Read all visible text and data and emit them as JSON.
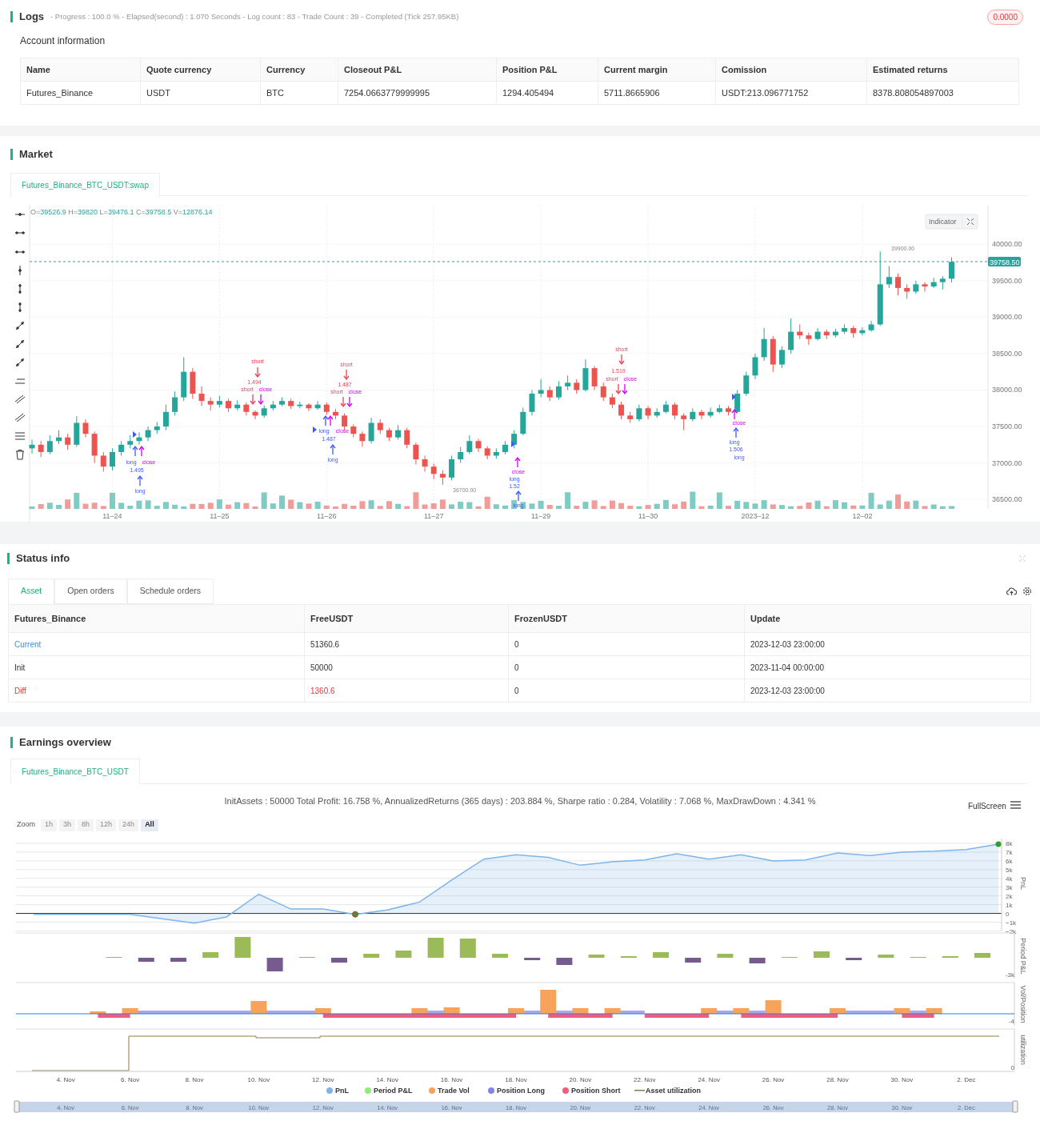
{
  "logs": {
    "title": "Logs",
    "summary": "- Progress : 100.0 % - Elapsed(second) : 1.070  Seconds - Log count : 83 - Trade Count : 39 - Completed (Tick 257.95KB)",
    "badge": "0.0000"
  },
  "account": {
    "title": "Account information",
    "columns": [
      "Name",
      "Quote currency",
      "Currency",
      "Closeout P&L",
      "Position P&L",
      "Current margin",
      "Comission",
      "Estimated returns"
    ],
    "rows": [
      [
        "Futures_Binance",
        "USDT",
        "BTC",
        "7254.0663779999995",
        "1294.405494",
        "5711.8665906",
        "USDT:213.096771752",
        "8378.808054897003"
      ]
    ]
  },
  "market": {
    "title": "Market",
    "tabs": [
      {
        "label": "Futures_Binance_BTC_USDT:swap",
        "selected": true
      }
    ],
    "ohlc": [
      {
        "key": "O=",
        "value": "39526.9"
      },
      {
        "key": "H=",
        "value": "39820"
      },
      {
        "key": "L=",
        "value": "39476.1"
      },
      {
        "key": "C=",
        "value": "39758.5"
      },
      {
        "key": "V=",
        "value": "12876.14"
      }
    ],
    "indicator_button": "Indicator",
    "last_price": "39758.50",
    "high_label": "39900.00",
    "low_label": "36700.00",
    "chart_data": {
      "type": "candlestick",
      "grid": true,
      "ylim": [
        36370,
        40540
      ],
      "categories": [
        null,
        null,
        null,
        null,
        null,
        null,
        null,
        null,
        null,
        "11–24",
        null,
        null,
        null,
        null,
        null,
        null,
        null,
        null,
        null,
        null,
        null,
        "11–25",
        null,
        null,
        null,
        null,
        null,
        null,
        null,
        null,
        null,
        null,
        null,
        "11–26",
        null,
        null,
        null,
        null,
        null,
        null,
        null,
        null,
        null,
        null,
        null,
        "11–27",
        null,
        null,
        null,
        null,
        null,
        null,
        null,
        null,
        null,
        null,
        null,
        "11–29",
        null,
        null,
        null,
        null,
        null,
        null,
        null,
        null,
        null,
        null,
        null,
        "11–30",
        null,
        null,
        null,
        null,
        null,
        null,
        null,
        null,
        null,
        null,
        null,
        "2023–12",
        null,
        null,
        null,
        null,
        null,
        null,
        null,
        null,
        null,
        null,
        null,
        "12–02",
        null,
        null,
        null,
        null,
        null,
        null,
        null,
        null,
        null,
        null
      ],
      "ohlc": [
        [
          37200,
          37320,
          37130,
          37250
        ],
        [
          37250,
          37300,
          37080,
          37150
        ],
        [
          37150,
          37380,
          37120,
          37300
        ],
        [
          37300,
          37450,
          37260,
          37350
        ],
        [
          37350,
          37400,
          37180,
          37250
        ],
        [
          37250,
          37640,
          37220,
          37550
        ],
        [
          37550,
          37600,
          37350,
          37400
        ],
        [
          37400,
          37430,
          37000,
          37100
        ],
        [
          37100,
          37150,
          36880,
          36950
        ],
        [
          36950,
          37200,
          36900,
          37150
        ],
        [
          37150,
          37300,
          37100,
          37250
        ],
        [
          37250,
          37380,
          37200,
          37300
        ],
        [
          37300,
          37420,
          37250,
          37350
        ],
        [
          37350,
          37500,
          37300,
          37450
        ],
        [
          37450,
          37560,
          37400,
          37500
        ],
        [
          37500,
          37800,
          37450,
          37700
        ],
        [
          37700,
          37980,
          37650,
          37900
        ],
        [
          37900,
          38450,
          37850,
          38250
        ],
        [
          38250,
          38300,
          37880,
          37950
        ],
        [
          37950,
          38050,
          37780,
          37850
        ],
        [
          37850,
          37900,
          37720,
          37800
        ],
        [
          37800,
          37920,
          37760,
          37850
        ],
        [
          37850,
          37880,
          37700,
          37750
        ],
        [
          37750,
          37860,
          37720,
          37800
        ],
        [
          37800,
          37830,
          37650,
          37700
        ],
        [
          37700,
          37720,
          37600,
          37650
        ],
        [
          37650,
          37790,
          37620,
          37750
        ],
        [
          37750,
          37850,
          37720,
          37800
        ],
        [
          37800,
          37900,
          37780,
          37850
        ],
        [
          37850,
          37880,
          37740,
          37780
        ],
        [
          37780,
          37840,
          37750,
          37800
        ],
        [
          37800,
          37820,
          37710,
          37750
        ],
        [
          37750,
          37850,
          37730,
          37800
        ],
        [
          37800,
          37830,
          37660,
          37700
        ],
        [
          37700,
          37740,
          37600,
          37650
        ],
        [
          37650,
          37680,
          37450,
          37500
        ],
        [
          37500,
          37530,
          37350,
          37400
        ],
        [
          37400,
          37430,
          37220,
          37300
        ],
        [
          37300,
          37620,
          37270,
          37550
        ],
        [
          37550,
          37600,
          37400,
          37450
        ],
        [
          37450,
          37480,
          37300,
          37350
        ],
        [
          37350,
          37520,
          37320,
          37450
        ],
        [
          37450,
          37480,
          37200,
          37250
        ],
        [
          37250,
          37280,
          36980,
          37050
        ],
        [
          37050,
          37100,
          36880,
          36950
        ],
        [
          36950,
          36990,
          36780,
          36850
        ],
        [
          36850,
          36900,
          36700,
          36800
        ],
        [
          36800,
          37100,
          36760,
          37050
        ],
        [
          37050,
          37220,
          37000,
          37150
        ],
        [
          37150,
          37380,
          37120,
          37300
        ],
        [
          37300,
          37330,
          37150,
          37200
        ],
        [
          37200,
          37230,
          37050,
          37100
        ],
        [
          37100,
          37200,
          37060,
          37150
        ],
        [
          37150,
          37300,
          37120,
          37250
        ],
        [
          37250,
          37450,
          37200,
          37400
        ],
        [
          37400,
          37760,
          37380,
          37700
        ],
        [
          37700,
          38000,
          37650,
          37950
        ],
        [
          37950,
          38150,
          37900,
          38000
        ],
        [
          38000,
          38050,
          37850,
          37900
        ],
        [
          37900,
          38120,
          37870,
          38050
        ],
        [
          38050,
          38200,
          38000,
          38100
        ],
        [
          38100,
          38150,
          37950,
          38000
        ],
        [
          38000,
          38420,
          37980,
          38300
        ],
        [
          38300,
          38330,
          38000,
          38050
        ],
        [
          38050,
          38100,
          37850,
          37900
        ],
        [
          37900,
          37950,
          37750,
          37800
        ],
        [
          37800,
          37840,
          37600,
          37650
        ],
        [
          37650,
          37700,
          37550,
          37600
        ],
        [
          37600,
          37800,
          37570,
          37750
        ],
        [
          37750,
          37780,
          37600,
          37650
        ],
        [
          37650,
          37750,
          37620,
          37700
        ],
        [
          37700,
          37850,
          37680,
          37800
        ],
        [
          37800,
          37830,
          37600,
          37650
        ],
        [
          37650,
          37680,
          37450,
          37600
        ],
        [
          37600,
          37750,
          37570,
          37700
        ],
        [
          37700,
          37730,
          37600,
          37650
        ],
        [
          37650,
          37760,
          37620,
          37700
        ],
        [
          37700,
          37800,
          37680,
          37750
        ],
        [
          37750,
          37780,
          37650,
          37700
        ],
        [
          37700,
          38000,
          37680,
          37950
        ],
        [
          37950,
          38250,
          37920,
          38200
        ],
        [
          38200,
          38500,
          38150,
          38450
        ],
        [
          38450,
          38850,
          38400,
          38700
        ],
        [
          38700,
          38740,
          38250,
          38350
        ],
        [
          38350,
          38600,
          38300,
          38550
        ],
        [
          38550,
          38980,
          38500,
          38800
        ],
        [
          38800,
          38900,
          38700,
          38750
        ],
        [
          38750,
          38790,
          38620,
          38700
        ],
        [
          38700,
          38850,
          38680,
          38800
        ],
        [
          38800,
          38830,
          38700,
          38750
        ],
        [
          38750,
          38840,
          38720,
          38800
        ],
        [
          38800,
          38900,
          38770,
          38850
        ],
        [
          38850,
          38880,
          38720,
          38780
        ],
        [
          38780,
          38860,
          38750,
          38820
        ],
        [
          38820,
          38950,
          38800,
          38900
        ],
        [
          38900,
          39900,
          38880,
          39450
        ],
        [
          39450,
          39700,
          39400,
          39550
        ],
        [
          39550,
          39600,
          39300,
          39400
        ],
        [
          39400,
          39450,
          39250,
          39350
        ],
        [
          39350,
          39500,
          39320,
          39450
        ],
        [
          39450,
          39480,
          39350,
          39420
        ],
        [
          39420,
          39540,
          39400,
          39480
        ],
        [
          39480,
          39560,
          39380,
          39526.9
        ],
        [
          39526.9,
          39820,
          39476.1,
          39758.5
        ]
      ],
      "yticks": [
        {
          "value": 40000,
          "label": "40000.00"
        },
        {
          "value": 39500,
          "label": "39500.00"
        },
        {
          "value": 39000,
          "label": "39000.00"
        },
        {
          "value": 38500,
          "label": "38500.00"
        },
        {
          "value": 38000,
          "label": "38000.00"
        },
        {
          "value": 37500,
          "label": "37500.00"
        },
        {
          "value": 37000,
          "label": "37000.00"
        },
        {
          "value": 36500,
          "label": "36500.00"
        }
      ]
    },
    "markers": [
      {
        "kind": "long",
        "label": "long"
      },
      {
        "kind": "close",
        "label": "close"
      },
      {
        "kind": "long",
        "label": "1.495"
      },
      {
        "kind": "long",
        "label": "long"
      },
      {
        "kind": "short",
        "label": "short"
      },
      {
        "kind": "short",
        "label": "1.494"
      },
      {
        "kind": "short",
        "label": "short"
      },
      {
        "kind": "close",
        "label": "close"
      },
      {
        "kind": "long",
        "label": "long"
      },
      {
        "kind": "close",
        "label": "close"
      },
      {
        "kind": "long",
        "label": "1.487"
      },
      {
        "kind": "long",
        "label": "long"
      },
      {
        "kind": "short",
        "label": "short"
      },
      {
        "kind": "short",
        "label": "1.487"
      },
      {
        "kind": "short",
        "label": "short"
      },
      {
        "kind": "close",
        "label": "close"
      },
      {
        "kind": "close",
        "label": "close"
      },
      {
        "kind": "long",
        "label": "long"
      },
      {
        "kind": "long",
        "label": "1.52"
      },
      {
        "kind": "long",
        "label": "long"
      },
      {
        "kind": "short",
        "label": "short"
      },
      {
        "kind": "short",
        "label": "1.519"
      },
      {
        "kind": "short",
        "label": "short"
      },
      {
        "kind": "close",
        "label": "close"
      },
      {
        "kind": "close",
        "label": "close"
      },
      {
        "kind": "long",
        "label": "long"
      },
      {
        "kind": "long",
        "label": "1.506"
      },
      {
        "kind": "long",
        "label": "long"
      }
    ]
  },
  "status": {
    "title": "Status info",
    "tabs": [
      {
        "label": "Asset",
        "selected": true
      },
      {
        "label": "Open orders",
        "selected": false
      },
      {
        "label": "Schedule orders",
        "selected": false
      }
    ],
    "columns": [
      "Futures_Binance",
      "FreeUSDT",
      "FrozenUSDT",
      "Update"
    ],
    "rows": [
      {
        "kind": "current",
        "cells": [
          "Current",
          "51360.6",
          "0",
          "2023-12-03 23:00:00"
        ]
      },
      {
        "kind": "init",
        "cells": [
          "Init",
          "50000",
          "0",
          "2023-11-04 00:00:00"
        ]
      },
      {
        "kind": "diff",
        "cells": [
          "Diff",
          "1360.6",
          "0",
          "2023-12-03 23:00:00"
        ]
      }
    ]
  },
  "earnings": {
    "title": "Earnings overview",
    "tabs": [
      {
        "label": "Futures_Binance_BTC_USDT",
        "selected": true
      }
    ],
    "summary": "InitAssets : 50000 Total Profit: 16.758 %, AnnualizedReturns (365 days) : 203.884 %, Sharpe ratio : 0.284, Volatility : 7.068 %, MaxDrawDown : 4.341 %",
    "fullscreen": "FullScreen",
    "zoom_label": "Zoom",
    "zoom_buttons": [
      {
        "label": "1h",
        "selected": false
      },
      {
        "label": "3h",
        "selected": false
      },
      {
        "label": "8h",
        "selected": false
      },
      {
        "label": "12h",
        "selected": false
      },
      {
        "label": "24h",
        "selected": false
      },
      {
        "label": "All",
        "selected": true
      }
    ],
    "chart_data": {
      "type": "area",
      "ylabel": "PnL",
      "grid": true,
      "ylim": [
        -2000,
        8500
      ],
      "series": [
        {
          "color": "#7cb5ec",
          "values": [
            -100,
            -100,
            -100,
            -100,
            -600,
            -1100,
            -400,
            2200,
            500,
            500,
            -100,
            400,
            1300,
            3800,
            6200,
            6700,
            6400,
            5500,
            5900,
            6100,
            6800,
            6200,
            6700,
            6000,
            6100,
            6900,
            6600,
            7000,
            7100,
            7300,
            7900
          ]
        }
      ],
      "yticks": [
        {
          "value": 8000,
          "label": "8k"
        },
        {
          "value": 7000,
          "label": "7k"
        },
        {
          "value": 6000,
          "label": "6k"
        },
        {
          "value": 5000,
          "label": "5k"
        },
        {
          "value": 4000,
          "label": "4k"
        },
        {
          "value": 3000,
          "label": "3k"
        },
        {
          "value": 2000,
          "label": "2k"
        },
        {
          "value": 1000,
          "label": "1k"
        },
        {
          "value": 0,
          "label": "0"
        },
        {
          "value": -1000,
          "label": "−1k"
        },
        {
          "value": -2000,
          "label": "−2k"
        }
      ]
    },
    "x_axis_labels": [
      "4. Nov",
      "6. Nov",
      "8. Nov",
      "10. Nov",
      "12. Nov",
      "14. Nov",
      "16. Nov",
      "18. Nov",
      "20. Nov",
      "22. Nov",
      "24. Nov",
      "26. Nov",
      "28. Nov",
      "30. Nov",
      "2. Dec"
    ],
    "panels": [
      {
        "label": "Period P&L",
        "tick": "-3k"
      },
      {
        "label": "Vol/Position",
        "tick": "-4"
      },
      {
        "label": "utilization",
        "tick": "0"
      }
    ],
    "legend": [
      {
        "kind": "dot",
        "name": "PnL",
        "color": "#7cb5ec"
      },
      {
        "kind": "dot",
        "name": "Period P&L",
        "color": "#90ed7d"
      },
      {
        "kind": "dot",
        "name": "Trade Vol",
        "color": "#f7a35c"
      },
      {
        "kind": "dot",
        "name": "Position Long",
        "color": "#8085e9"
      },
      {
        "kind": "dot",
        "name": "Position Short",
        "color": "#f15c80"
      },
      {
        "kind": "line",
        "name": "Asset utilization",
        "color": "#8d7b45"
      }
    ],
    "navigator_labels": [
      "4. Nov",
      "6. Nov",
      "8. Nov",
      "10. Nov",
      "12. Nov",
      "14. Nov",
      "16. Nov",
      "18. Nov",
      "20. Nov",
      "22. Nov",
      "24. Nov",
      "26. Nov",
      "28. Nov",
      "30. Nov",
      "2. Dec"
    ]
  }
}
